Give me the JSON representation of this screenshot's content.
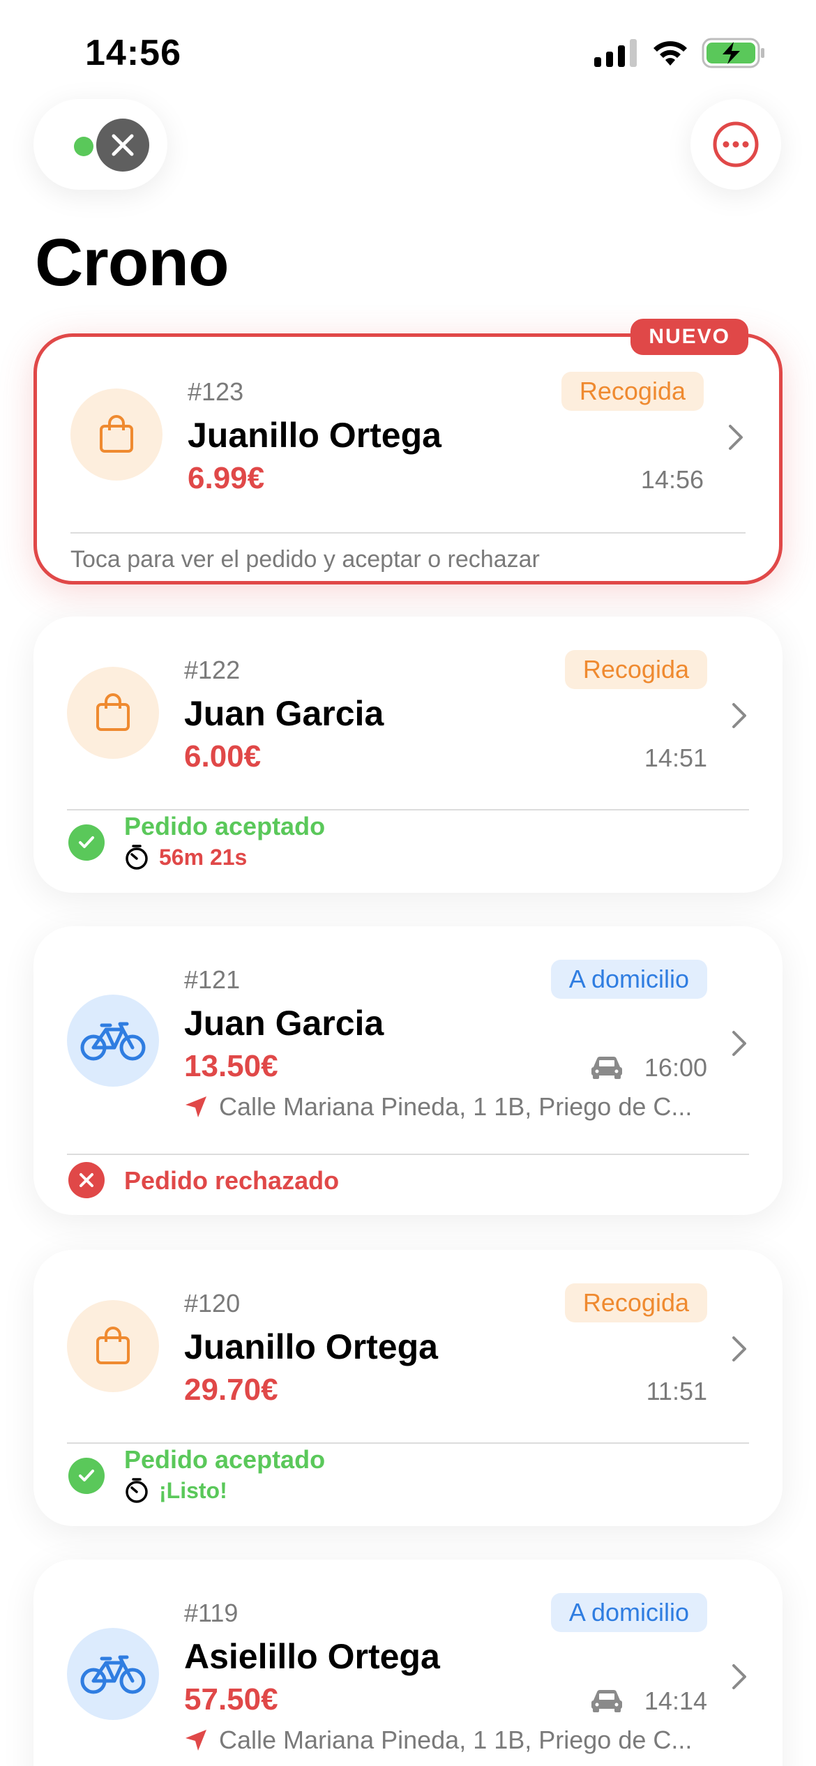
{
  "status_bar": {
    "time": "14:56"
  },
  "page_title": "Crono",
  "orders": [
    {
      "number": "#123",
      "type_label": "Recogida",
      "customer": "Juanillo Ortega",
      "price": "6.99€",
      "time": "14:56",
      "new_badge": "NUEVO",
      "hint": "Toca para ver el pedido y aceptar o rechazar"
    },
    {
      "number": "#122",
      "type_label": "Recogida",
      "customer": "Juan Garcia",
      "price": "6.00€",
      "time": "14:51",
      "status": "Pedido aceptado",
      "timer": "56m 21s"
    },
    {
      "number": "#121",
      "type_label": "A domicilio",
      "customer": "Juan Garcia",
      "price": "13.50€",
      "time": "16:00",
      "address": "Calle Mariana Pineda, 1 1B, Priego de C...",
      "status": "Pedido rechazado"
    },
    {
      "number": "#120",
      "type_label": "Recogida",
      "customer": "Juanillo Ortega",
      "price": "29.70€",
      "time": "11:51",
      "status": "Pedido aceptado",
      "timer": "¡Listo!"
    },
    {
      "number": "#119",
      "type_label": "A domicilio",
      "customer": "Asielillo Ortega",
      "price": "57.50€",
      "time": "14:14",
      "address": "Calle Mariana Pineda, 1 1B, Priego de C..."
    }
  ],
  "colors": {
    "accent_red": "#e04848",
    "pickup_orange": "#ef8a30",
    "delivery_blue": "#2f7de1",
    "success_green": "#5ac85a"
  },
  "icons": {
    "pickup": "shopping-bag-icon",
    "delivery": "bicycle-icon",
    "vehicle": "car-icon",
    "location": "location-arrow-icon",
    "timer": "stopwatch-icon"
  }
}
